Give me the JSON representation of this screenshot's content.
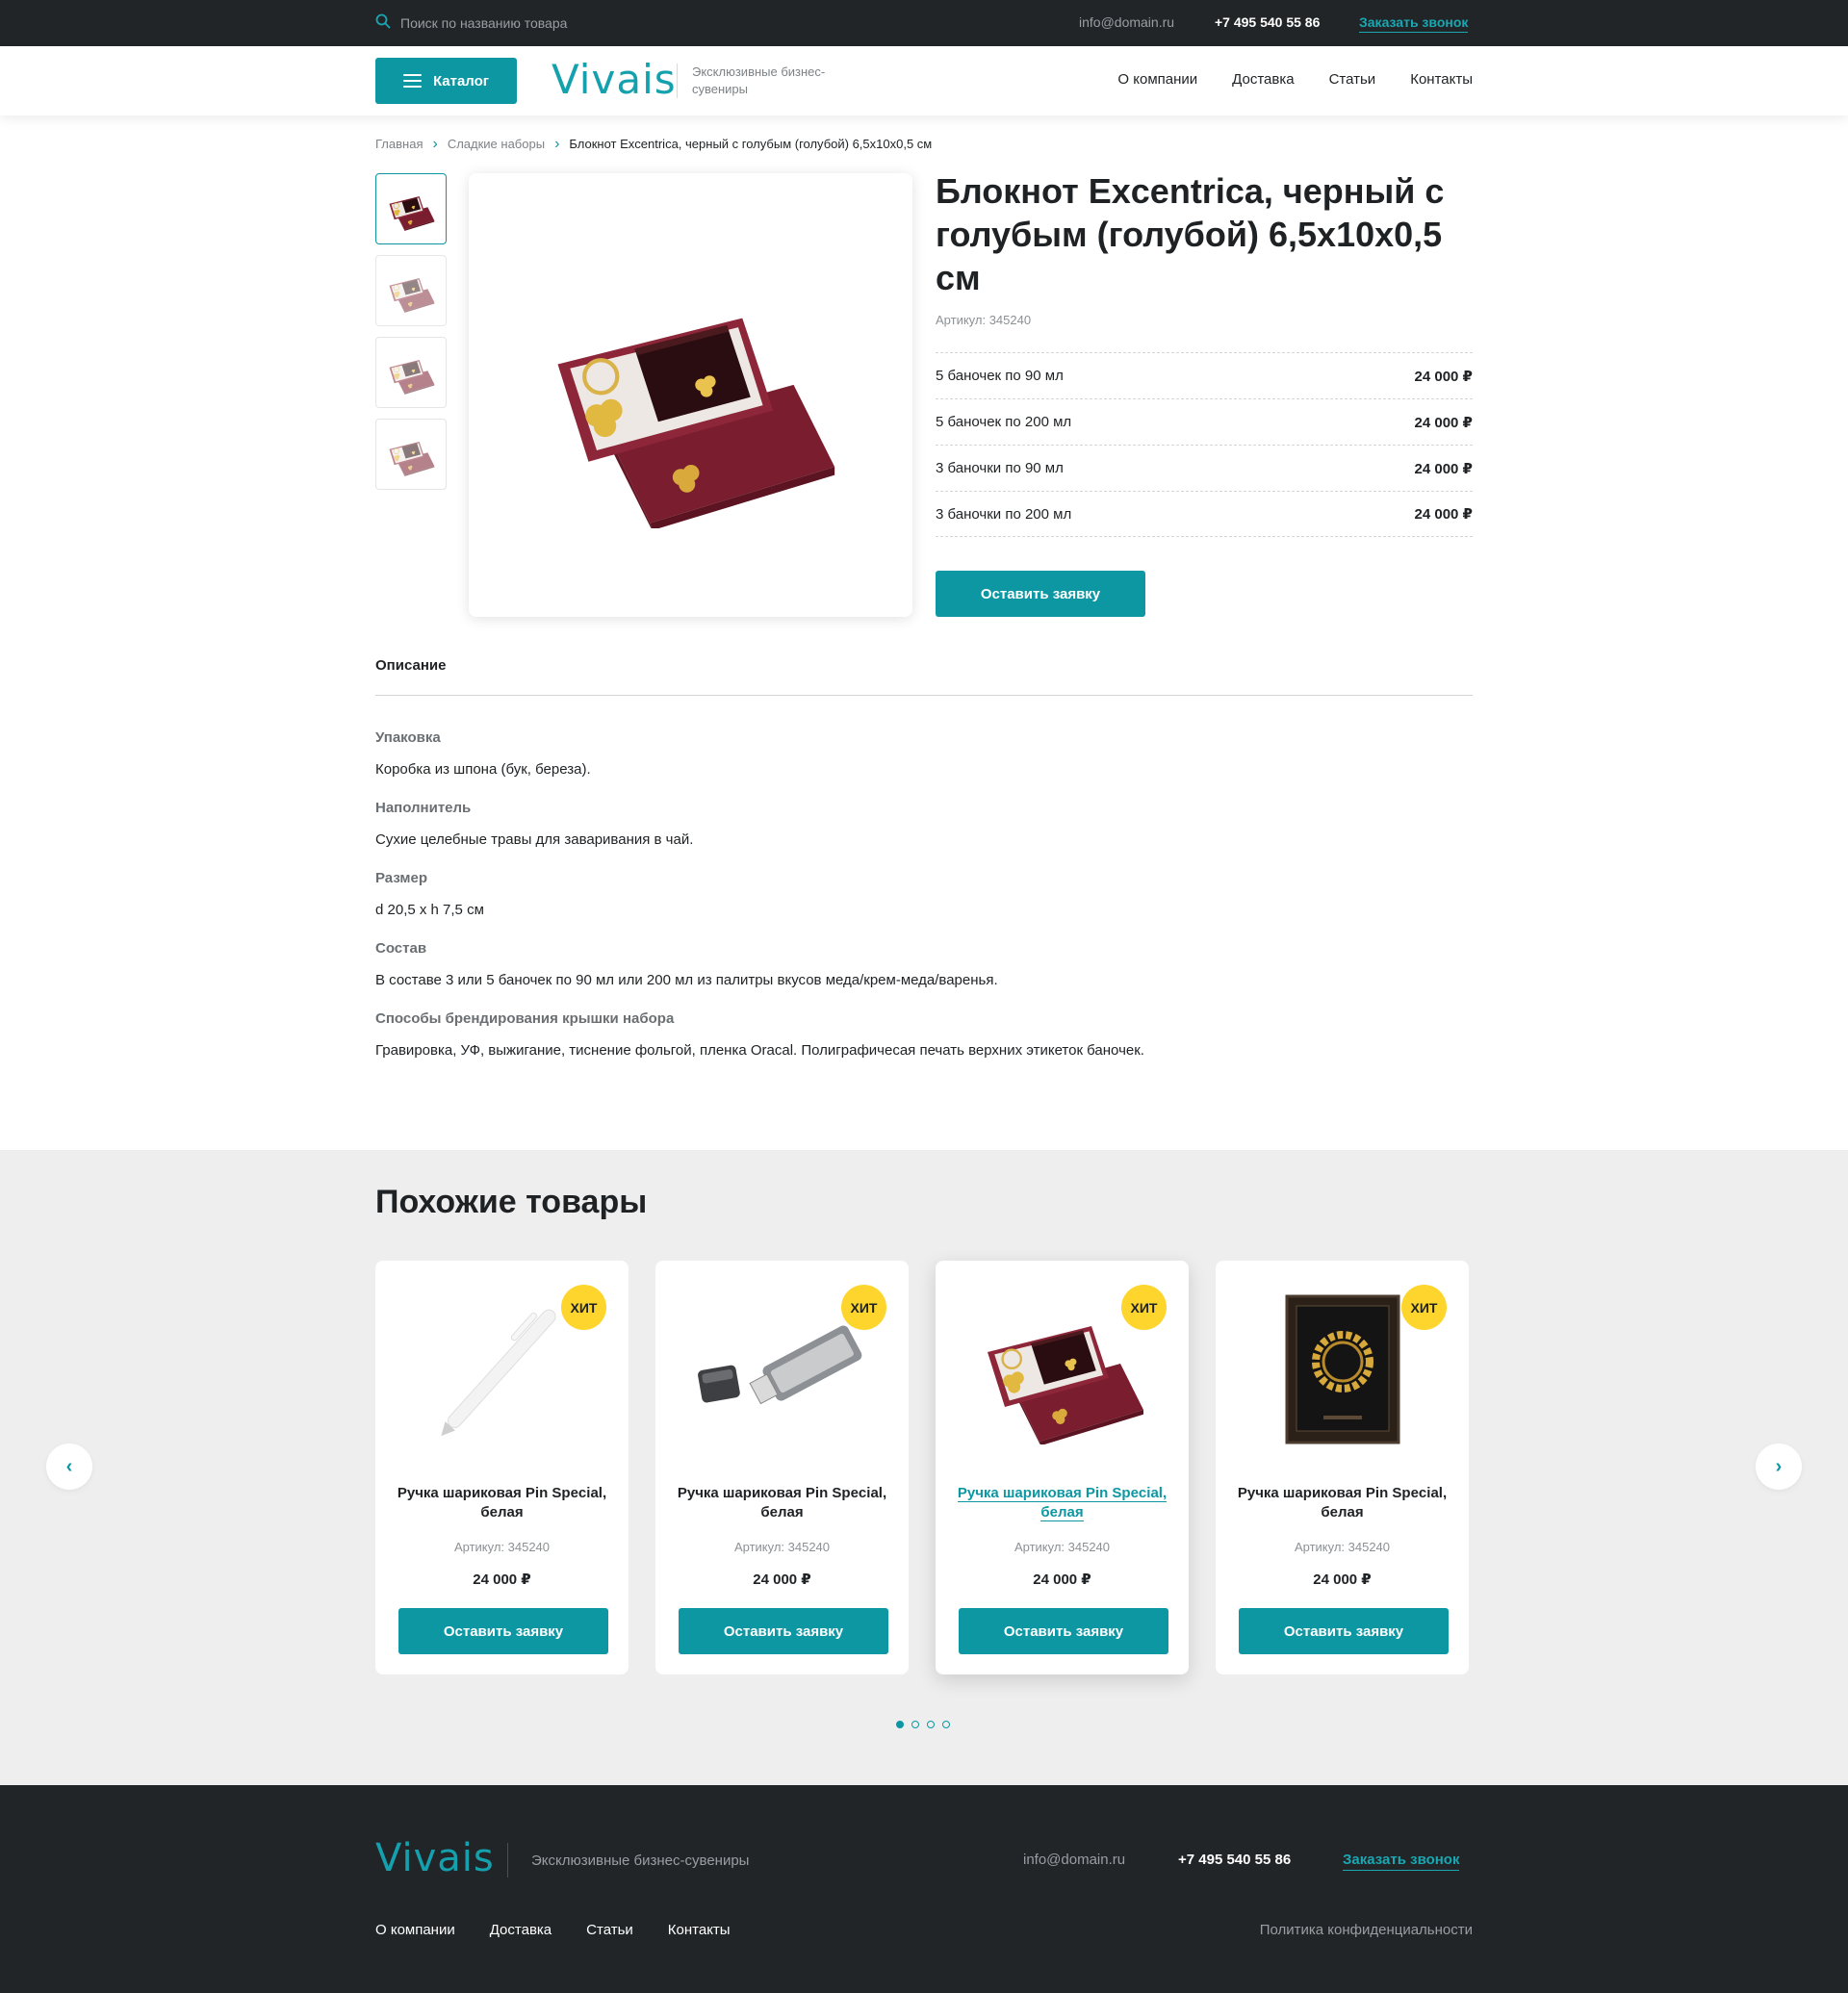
{
  "topbar": {
    "search_placeholder": "Поиск по названию товара",
    "email": "info@domain.ru",
    "phone": "+7 495 540 55 86",
    "callback": "Заказать звонок"
  },
  "header": {
    "catalog": "Каталог",
    "logo": "Vivais",
    "tagline": "Эксклюзивные бизнес-сувениры",
    "nav": [
      "О компании",
      "Доставка",
      "Статьи",
      "Контакты"
    ]
  },
  "breadcrumbs": [
    "Главная",
    "Сладкие наборы",
    "Блокнот Excentrica, черный с голубым (голубой) 6,5x10x0,5 см"
  ],
  "product": {
    "title": "Блокнот Excentrica, черный с голубым (голубой) 6,5x10x0,5 см",
    "article": "Артикул: 345240",
    "prices": [
      {
        "label": "5 баночек по 90 мл",
        "value": "24 000 ₽"
      },
      {
        "label": "5 баночек по 200 мл",
        "value": "24 000 ₽"
      },
      {
        "label": "3 баночки по 90 мл",
        "value": "24 000 ₽"
      },
      {
        "label": "3 баночки по 200 мл",
        "value": "24 000 ₽"
      }
    ],
    "request": "Оставить заявку"
  },
  "description": {
    "tab": "Описание",
    "items": [
      {
        "title": "Упаковка",
        "text": "Коробка из шпона (бук, береза)."
      },
      {
        "title": "Наполнитель",
        "text": "Сухие целебные травы для заваривания в чай."
      },
      {
        "title": "Размер",
        "text": "d 20,5 x h 7,5 см"
      },
      {
        "title": "Состав",
        "text": "В составе 3 или 5 баночек по 90 мл или 200 мл из палитры вкусов меда/крем-меда/варенья."
      },
      {
        "title": "Способы брендирования крышки набора",
        "text": "Гравировка, УФ, выжигание, тиснение фольгой, пленка Oracal. Полиграфичесая печать верхних этикеток баночек."
      }
    ]
  },
  "similar": {
    "title": "Похожие товары",
    "cards": [
      {
        "badge": "ХИТ",
        "name": "Ручка шариковая Pin Special, белая",
        "article": "Артикул: 345240",
        "price": "24 000 ₽",
        "button": "Оставить заявку",
        "image": "pen"
      },
      {
        "badge": "ХИТ",
        "name": "Ручка шариковая Pin Special, белая",
        "article": "Артикул: 345240",
        "price": "24 000 ₽",
        "button": "Оставить заявку",
        "image": "usb-drive"
      },
      {
        "badge": "ХИТ",
        "name": "Ручка шариковая Pin Special, белая",
        "article": "Артикул: 345240",
        "price": "24 000 ₽",
        "button": "Оставить заявку",
        "image": "gift-box"
      },
      {
        "badge": "ХИТ",
        "name": "Ручка шариковая Pin Special, белая",
        "article": "Артикул: 345240",
        "price": "24 000 ₽",
        "button": "Оставить заявку",
        "image": "laurel-frame"
      }
    ],
    "active_page": 1,
    "pages": 4
  },
  "footer": {
    "logo": "Vivais",
    "tagline": "Эксклюзивные бизнес-сувениры",
    "email": "info@domain.ru",
    "phone": "+7 495 540 55 86",
    "callback": "Заказать звонок",
    "nav": [
      "О компании",
      "Доставка",
      "Статьи",
      "Контакты"
    ],
    "policy": "Политика конфиденциальности"
  },
  "colors": {
    "accent": "#0c97a3",
    "dark": "#212528",
    "badge": "#fdd52c"
  }
}
